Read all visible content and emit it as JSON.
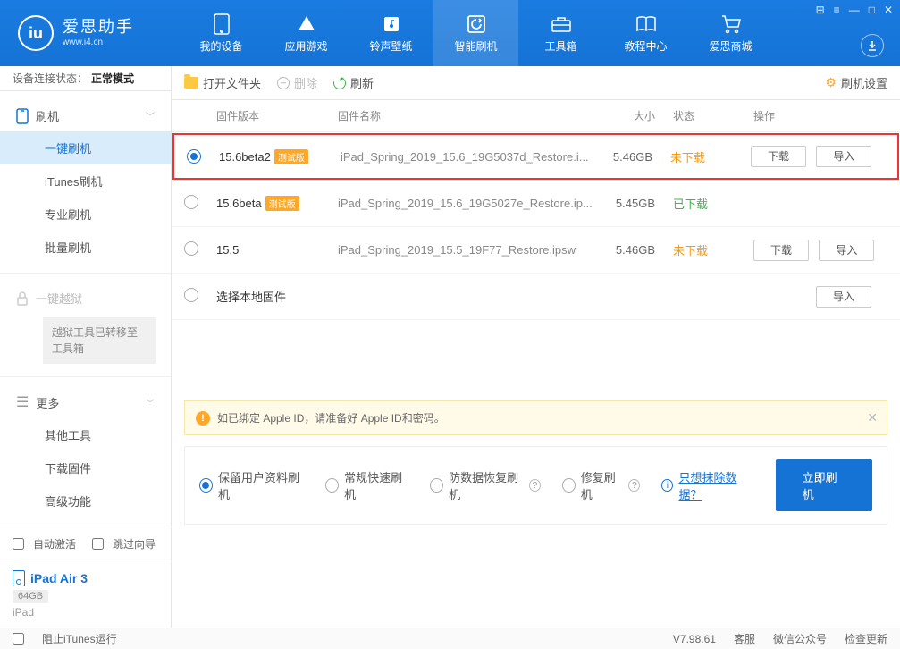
{
  "app": {
    "name": "爱思助手",
    "url": "www.i4.cn"
  },
  "nav": [
    {
      "label": "我的设备"
    },
    {
      "label": "应用游戏"
    },
    {
      "label": "铃声壁纸"
    },
    {
      "label": "智能刷机"
    },
    {
      "label": "工具箱"
    },
    {
      "label": "教程中心"
    },
    {
      "label": "爱思商城"
    }
  ],
  "status": {
    "label": "设备连接状态：",
    "value": "正常模式"
  },
  "side": {
    "flash": "刷机",
    "items": [
      "一键刷机",
      "iTunes刷机",
      "专业刷机",
      "批量刷机"
    ],
    "jailbreak": "一键越狱",
    "jb_note": "越狱工具已转移至工具箱",
    "more": "更多",
    "more_items": [
      "其他工具",
      "下载固件",
      "高级功能"
    ]
  },
  "auto": {
    "activate": "自动激活",
    "skip": "跳过向导"
  },
  "device": {
    "name": "iPad Air 3",
    "capacity": "64GB",
    "type": "iPad"
  },
  "toolbar": {
    "open": "打开文件夹",
    "delete": "删除",
    "refresh": "刷新",
    "settings": "刷机设置"
  },
  "columns": {
    "version": "固件版本",
    "name": "固件名称",
    "size": "大小",
    "status": "状态",
    "ops": "操作"
  },
  "firmware": [
    {
      "version": "15.6beta2",
      "beta": "测试版",
      "name": "iPad_Spring_2019_15.6_19G5037d_Restore.i...",
      "size": "5.46GB",
      "status": "未下载",
      "status_cls": "status-not",
      "download": "下载",
      "import": "导入"
    },
    {
      "version": "15.6beta",
      "beta": "测试版",
      "name": "iPad_Spring_2019_15.6_19G5027e_Restore.ip...",
      "size": "5.45GB",
      "status": "已下载",
      "status_cls": "status-done"
    },
    {
      "version": "15.5",
      "name": "iPad_Spring_2019_15.5_19F77_Restore.ipsw",
      "size": "5.46GB",
      "status": "未下载",
      "status_cls": "status-not",
      "download": "下载",
      "import": "导入"
    }
  ],
  "local_row": {
    "label": "选择本地固件",
    "import": "导入"
  },
  "warn": "如已绑定 Apple ID，请准备好 Apple ID和密码。",
  "options": {
    "keep": "保留用户资料刷机",
    "normal": "常规快速刷机",
    "anti": "防数据恢复刷机",
    "repair": "修复刷机",
    "erase": "只想抹除数据？",
    "go": "立即刷机"
  },
  "footer": {
    "block": "阻止iTunes运行",
    "version": "V7.98.61",
    "service": "客服",
    "wechat": "微信公众号",
    "update": "检查更新"
  }
}
